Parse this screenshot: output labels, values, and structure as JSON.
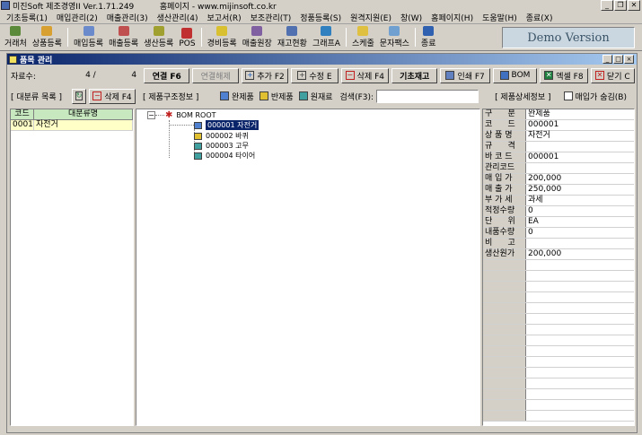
{
  "window": {
    "title": "미진Soft 제조경영II Ver.1.71.249          홈페이지 - www.mijinsoft.co.kr",
    "controls": [
      "_",
      "❐",
      "✕"
    ]
  },
  "menu": [
    "기초등록(1)",
    "매입관리(2)",
    "매출관리(3)",
    "생산관리(4)",
    "보고서(R)",
    "보조관리(T)",
    "정품등록(S)",
    "원격지원(E)",
    "창(W)",
    "홈페이지(H)",
    "도움말(H)",
    "종료(X)"
  ],
  "toolbar": {
    "buttons": [
      {
        "label": "거래처",
        "icon": "edit-icon",
        "color": "#5a8a3a"
      },
      {
        "label": "상품등록",
        "icon": "box-icon",
        "color": "#d8a030"
      },
      {
        "label": "매입등록",
        "icon": "doc-icon",
        "color": "#6a8acb"
      },
      {
        "label": "매출등록",
        "icon": "doc-icon",
        "color": "#c05050"
      },
      {
        "label": "생산등록",
        "icon": "gear-icon",
        "color": "#a0a030"
      },
      {
        "label": "POS",
        "icon": "pos-icon",
        "color": "#c03030"
      },
      {
        "label": "경비등록",
        "icon": "coin-icon",
        "color": "#d8c030"
      },
      {
        "label": "매출원장",
        "icon": "ledger-icon",
        "color": "#8060a0"
      },
      {
        "label": "재고현황",
        "icon": "stock-icon",
        "color": "#5070b0"
      },
      {
        "label": "그래프A",
        "icon": "graph-icon",
        "color": "#3080c0"
      },
      {
        "label": "스케줄",
        "icon": "clock-icon",
        "color": "#e0c040"
      },
      {
        "label": "문자팩스",
        "icon": "message-icon",
        "color": "#70a0d0"
      },
      {
        "label": "종료",
        "icon": "exit-icon",
        "color": "#3060b0"
      }
    ],
    "demo_label": "Demo Version"
  },
  "child": {
    "title": "품목 관리",
    "record_label": "자료수:",
    "record_current": "4 /",
    "record_total": "4",
    "actions": {
      "link": "연결 F6",
      "unlink": "연결해제",
      "add": "추가 F2",
      "edit": "수정 E",
      "delete": "삭제 F4",
      "base_stock": "기초재고",
      "print": "인쇄 F7",
      "bom": "BOM",
      "excel": "엑셀 F8",
      "close": "닫기 C"
    },
    "category_label": "[ 대분류 목록 ]",
    "category_delete": "삭제 F4",
    "structure_label": "[ 제품구조정보 ]",
    "legend": {
      "finished": "완제품",
      "semi": "반제품",
      "raw": "원재료"
    },
    "search_label": "검색(F3):",
    "search_value": "",
    "detail_label": "[ 제품상세정보 ]",
    "hide_purchase": "매입가 숨김(B)"
  },
  "category_grid": {
    "headers": [
      "코드",
      "대분류명"
    ],
    "rows": [
      {
        "code": "0001",
        "name": "자전거"
      }
    ]
  },
  "bom_tree": {
    "root": "BOM ROOT",
    "nodes": [
      {
        "code": "000001",
        "name": "자전거",
        "type": "finished",
        "selected": true
      },
      {
        "code": "000002",
        "name": "바퀴",
        "type": "semi",
        "selected": false
      },
      {
        "code": "000003",
        "name": "고무",
        "type": "raw",
        "selected": false
      },
      {
        "code": "000004",
        "name": "타이어",
        "type": "raw",
        "selected": false
      }
    ]
  },
  "detail": [
    {
      "key": "구      분",
      "value": "완제품"
    },
    {
      "key": "코      드",
      "value": "000001"
    },
    {
      "key": "상 품 명",
      "value": "자전거"
    },
    {
      "key": "규      격",
      "value": ""
    },
    {
      "key": "바 코 드",
      "value": "000001"
    },
    {
      "key": "관리코드",
      "value": ""
    },
    {
      "key": "매 입 가",
      "value": "200,000"
    },
    {
      "key": "매 출 가",
      "value": "250,000"
    },
    {
      "key": "부 가 세",
      "value": "과세"
    },
    {
      "key": "적정수량",
      "value": "0"
    },
    {
      "key": "단      위",
      "value": "EA"
    },
    {
      "key": "내품수량",
      "value": "0"
    },
    {
      "key": "비      고",
      "value": ""
    },
    {
      "key": "생산원가",
      "value": "200,000"
    }
  ]
}
